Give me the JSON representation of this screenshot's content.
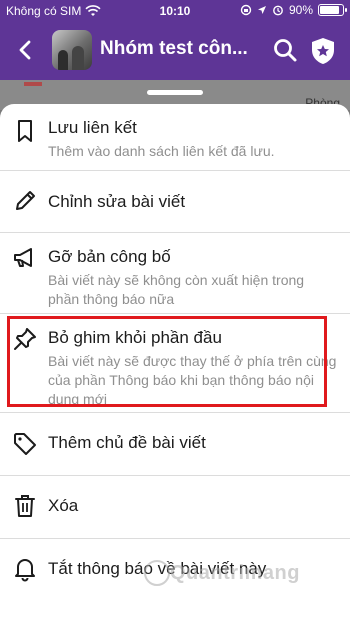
{
  "status_bar": {
    "carrier": "Không có SIM",
    "time": "10:10",
    "battery": "90%"
  },
  "header": {
    "title": "Nhóm test côn..."
  },
  "background": {
    "tab_hint": "Phòng"
  },
  "menu": {
    "items": [
      {
        "label": "Lưu liên kết",
        "description": "Thêm vào danh sách liên kết đã lưu.",
        "icon": "bookmark-icon"
      },
      {
        "label": "Chỉnh sửa bài viết",
        "description": "",
        "icon": "pencil-icon"
      },
      {
        "label": "Gỡ bản công bố",
        "description": "Bài viết này sẽ không còn xuất hiện trong phần thông báo nữa",
        "icon": "megaphone-icon"
      },
      {
        "label": "Bỏ ghim khỏi phần đầu",
        "description": "Bài viết này sẽ được thay thế ở phía trên cùng của phần Thông báo khi bạn thông báo nội dung mới",
        "icon": "pin-icon"
      },
      {
        "label": "Thêm chủ đề bài viết",
        "description": "",
        "icon": "tag-icon"
      },
      {
        "label": "Xóa",
        "description": "",
        "icon": "trash-icon"
      },
      {
        "label": "Tắt thông báo về bài viết này",
        "description": "",
        "icon": "bell-icon"
      }
    ]
  },
  "watermark": "Quantrimang",
  "colors": {
    "header_bg": "#5e3596",
    "highlight_border": "#e0191d",
    "description_text": "#8f8f8f"
  }
}
